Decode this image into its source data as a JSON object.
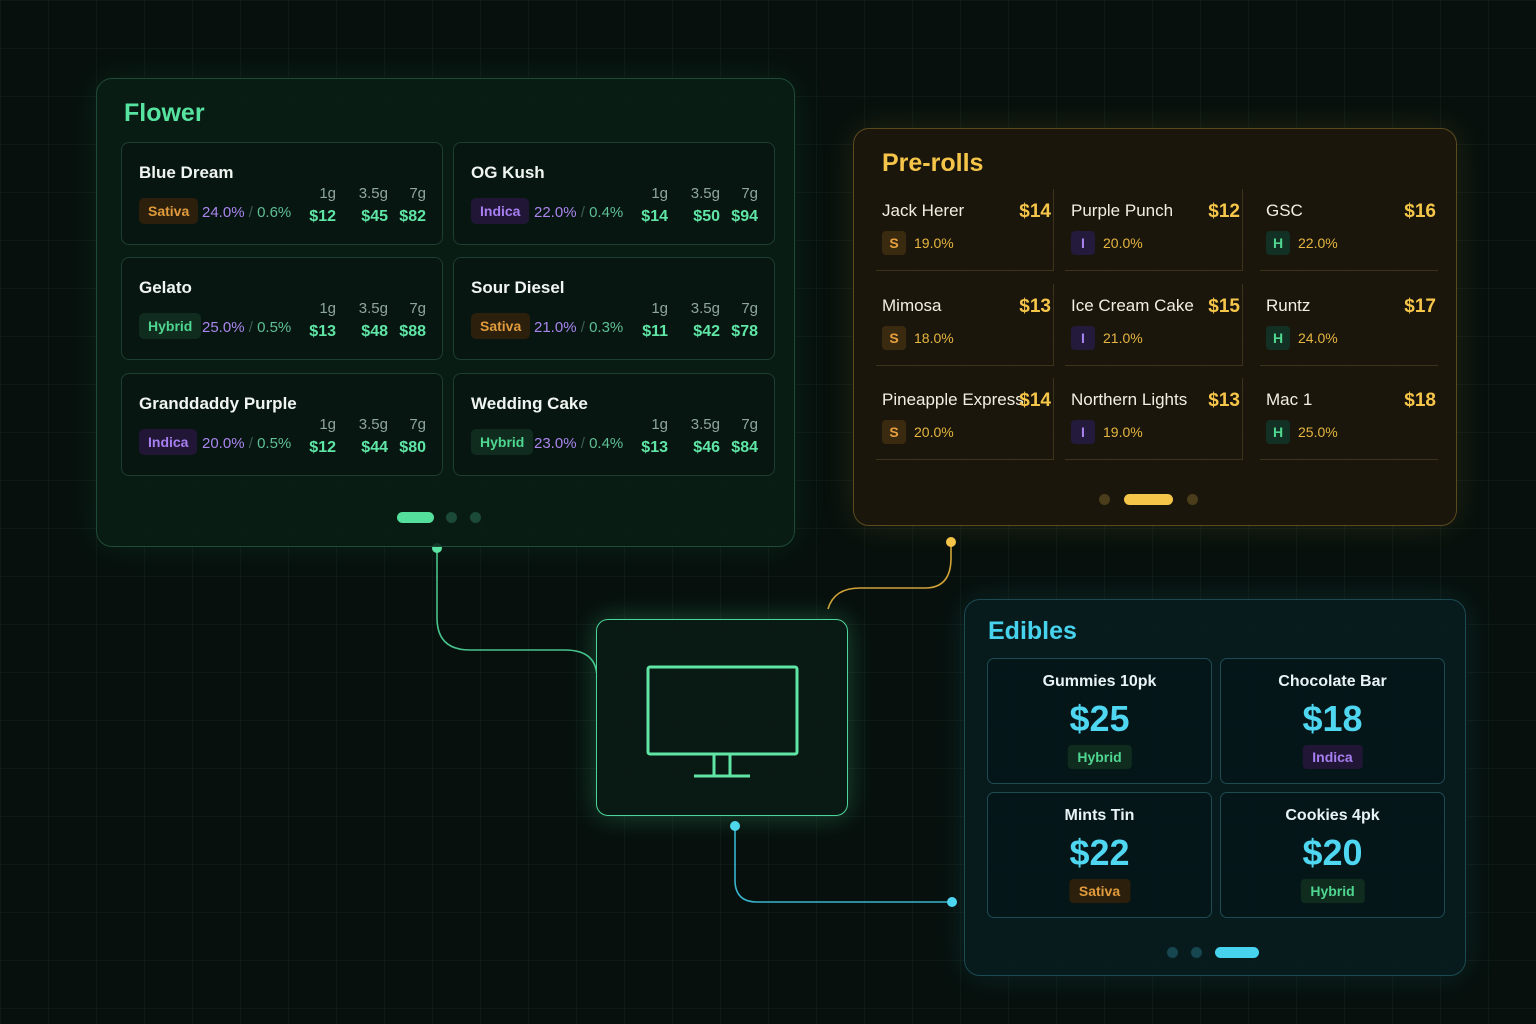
{
  "flower": {
    "title": "Flower",
    "weights": [
      "1g",
      "3.5g",
      "7g"
    ],
    "products": [
      {
        "name": "Blue Dream",
        "type": "Sativa",
        "thc": "24.0%",
        "cbd": "0.6%",
        "prices": [
          "$12",
          "$45",
          "$82"
        ]
      },
      {
        "name": "OG Kush",
        "type": "Indica",
        "thc": "22.0%",
        "cbd": "0.4%",
        "prices": [
          "$14",
          "$50",
          "$94"
        ]
      },
      {
        "name": "Gelato",
        "type": "Hybrid",
        "thc": "25.0%",
        "cbd": "0.5%",
        "prices": [
          "$13",
          "$48",
          "$88"
        ]
      },
      {
        "name": "Sour Diesel",
        "type": "Sativa",
        "thc": "21.0%",
        "cbd": "0.3%",
        "prices": [
          "$11",
          "$42",
          "$78"
        ]
      },
      {
        "name": "Granddaddy Purple",
        "type": "Indica",
        "thc": "20.0%",
        "cbd": "0.5%",
        "prices": [
          "$12",
          "$44",
          "$80"
        ]
      },
      {
        "name": "Wedding Cake",
        "type": "Hybrid",
        "thc": "23.0%",
        "cbd": "0.4%",
        "prices": [
          "$13",
          "$46",
          "$84"
        ]
      }
    ],
    "active_page": 1,
    "page_count": 3
  },
  "prerolls": {
    "title": "Pre-rolls",
    "products": [
      {
        "name": "Jack Herer",
        "price": "$14",
        "type": "S",
        "thc": "19.0%"
      },
      {
        "name": "Purple Punch",
        "price": "$12",
        "type": "I",
        "thc": "20.0%"
      },
      {
        "name": "GSC",
        "price": "$16",
        "type": "H",
        "thc": "22.0%"
      },
      {
        "name": "Mimosa",
        "price": "$13",
        "type": "S",
        "thc": "18.0%"
      },
      {
        "name": "Ice Cream Cake",
        "price": "$15",
        "type": "I",
        "thc": "21.0%"
      },
      {
        "name": "Runtz",
        "price": "$17",
        "type": "H",
        "thc": "24.0%"
      },
      {
        "name": "Pineapple Express",
        "price": "$14",
        "type": "S",
        "thc": "20.0%"
      },
      {
        "name": "Northern Lights",
        "price": "$13",
        "type": "I",
        "thc": "19.0%"
      },
      {
        "name": "Mac 1",
        "price": "$18",
        "type": "H",
        "thc": "25.0%"
      }
    ],
    "active_page": 2,
    "page_count": 3
  },
  "edibles": {
    "title": "Edibles",
    "products": [
      {
        "name": "Gummies 10pk",
        "price": "$25",
        "type": "Hybrid"
      },
      {
        "name": "Chocolate Bar",
        "price": "$18",
        "type": "Indica"
      },
      {
        "name": "Mints Tin",
        "price": "$22",
        "type": "Sativa"
      },
      {
        "name": "Cookies 4pk",
        "price": "$20",
        "type": "Hybrid"
      }
    ],
    "active_page": 3,
    "page_count": 3
  },
  "hub": {
    "icon": "monitor-icon"
  },
  "colors": {
    "flower_accent": "#57e3a0",
    "preroll_accent": "#f5c54a",
    "edible_accent": "#47d3ee",
    "sativa": "#e09b3c",
    "indica": "#a77ff0",
    "hybrid": "#4fd690"
  }
}
